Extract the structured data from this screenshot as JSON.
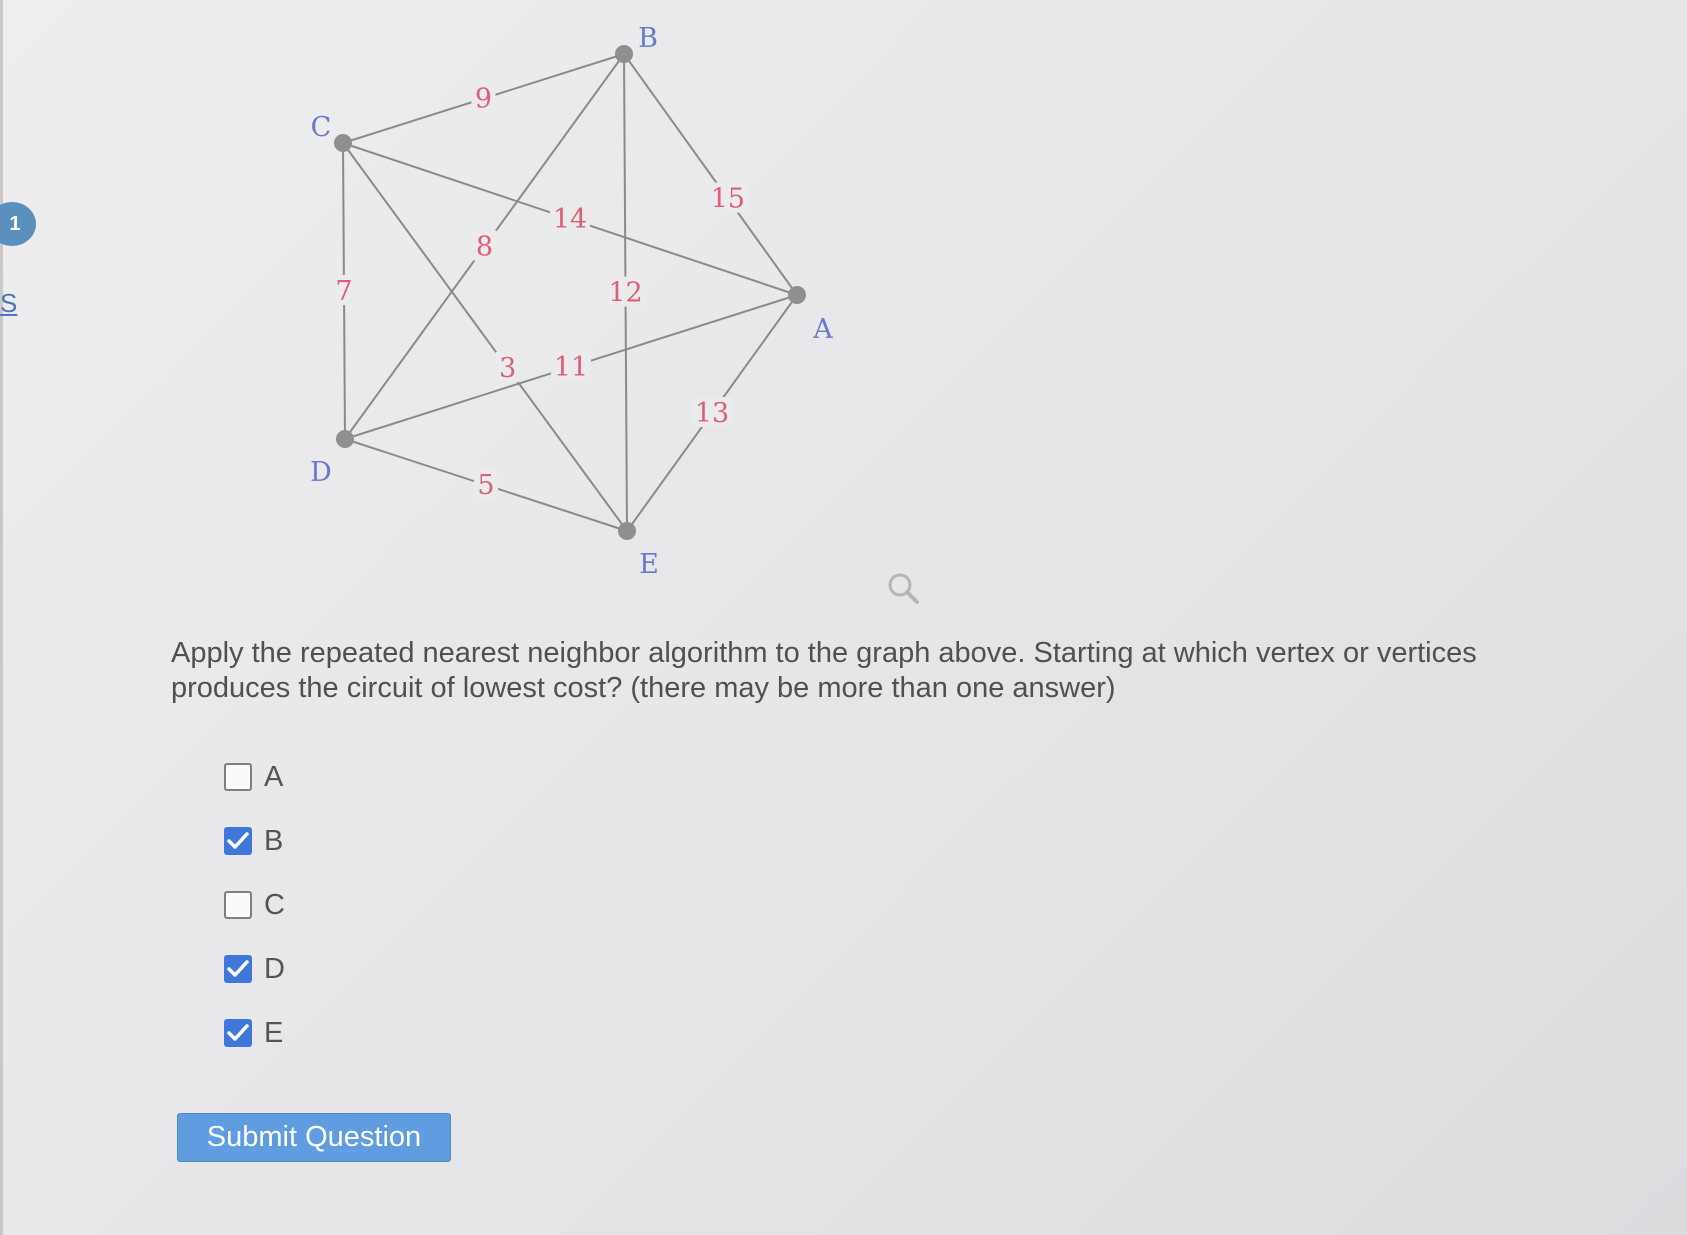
{
  "badge": {
    "number": "1"
  },
  "side_link": {
    "text": "S"
  },
  "graph": {
    "vertices": [
      {
        "id": "A",
        "label": "A"
      },
      {
        "id": "B",
        "label": "B"
      },
      {
        "id": "C",
        "label": "C"
      },
      {
        "id": "D",
        "label": "D"
      },
      {
        "id": "E",
        "label": "E"
      }
    ],
    "edges": [
      {
        "from": "C",
        "to": "B",
        "weight": "9"
      },
      {
        "from": "B",
        "to": "A",
        "weight": "15"
      },
      {
        "from": "C",
        "to": "A",
        "weight": "14"
      },
      {
        "from": "D",
        "to": "B",
        "weight": "8"
      },
      {
        "from": "C",
        "to": "D",
        "weight": "7"
      },
      {
        "from": "B",
        "to": "E",
        "weight": "12"
      },
      {
        "from": "C",
        "to": "E",
        "weight": "3"
      },
      {
        "from": "D",
        "to": "A",
        "weight": "11"
      },
      {
        "from": "A",
        "to": "E",
        "weight": "13"
      },
      {
        "from": "D",
        "to": "E",
        "weight": "5"
      }
    ],
    "colors": {
      "weight_label": "#dc5f75",
      "vertex_label": "#6878cc",
      "edge": "#8a8a8a",
      "node": "#8f8f8f"
    }
  },
  "zoom_icon": {
    "icon": "magnifier-icon"
  },
  "question": {
    "text": "Apply the repeated nearest neighbor algorithm to the graph above. Starting at which vertex or vertices produces the circuit of lowest cost? (there may be more than one answer)"
  },
  "options": [
    {
      "label": "A",
      "checked": false
    },
    {
      "label": "B",
      "checked": true
    },
    {
      "label": "C",
      "checked": false
    },
    {
      "label": "D",
      "checked": true
    },
    {
      "label": "E",
      "checked": true
    }
  ],
  "submit": {
    "label": "Submit Question",
    "color": "#5f9de0"
  }
}
